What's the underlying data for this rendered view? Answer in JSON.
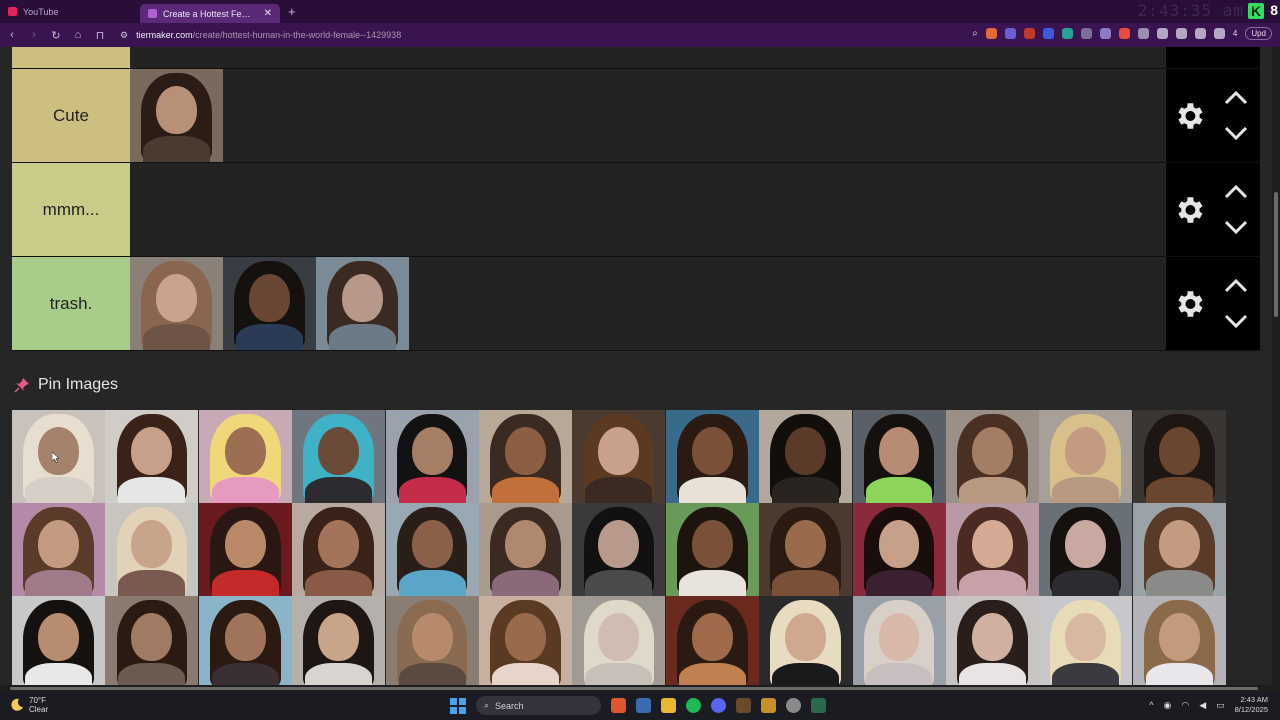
{
  "browser": {
    "tabs": [
      {
        "title": "YouTube",
        "color": "#e0245e",
        "active": false
      },
      {
        "title": "Create a Hottest Females Celeb",
        "color": "#b060d0",
        "active": true
      }
    ],
    "clock_overlay": "2:43:35 am",
    "url_host": "tiermaker.com",
    "url_path": "/create/hottest-human-in-the-world-female--1429938",
    "update_label": "Upd",
    "badge_count": "4"
  },
  "tiers": [
    {
      "label": "",
      "color": "#cdbf80",
      "items": 0
    },
    {
      "label": "Cute",
      "color": "#cdbf80",
      "items": 1
    },
    {
      "label": "mmm...",
      "color": "#c8cc88",
      "items": 0
    },
    {
      "label": "trash.",
      "color": "#a8cd8a",
      "items": 3
    }
  ],
  "pin_images": {
    "label": "Pin Images"
  },
  "taskbar": {
    "temp": "70°F",
    "condition": "Clear",
    "search_label": "Search",
    "time": "2:43 AM",
    "date": "8/12/2025"
  },
  "colors": {
    "accent_tab": "#5a2a78",
    "pin": "#e85a8a"
  }
}
